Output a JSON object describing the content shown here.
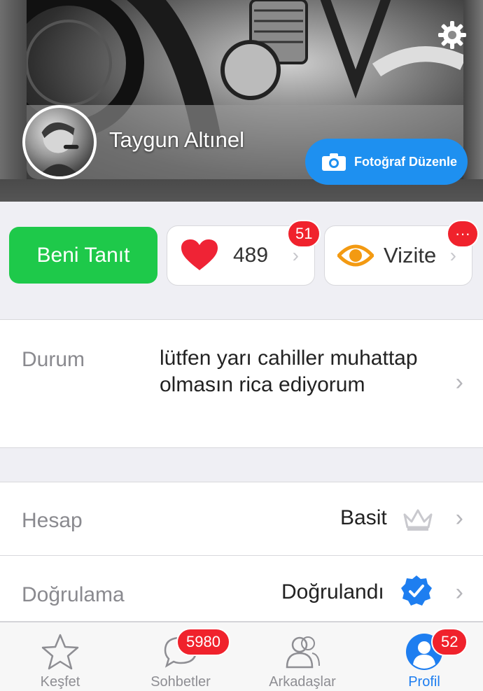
{
  "profile": {
    "name": "Taygun Altınel",
    "edit_photo_label": "Fotoğraf Düzenle"
  },
  "actions": {
    "intro_label": "Beni Tanıt",
    "likes_count": "489",
    "likes_badge": "51",
    "visits_label": "Vizite",
    "visits_badge": "···"
  },
  "status": {
    "label": "Durum",
    "text": "lütfen yarı cahiller muhattap olmasın rica ediyorum"
  },
  "account": {
    "label": "Hesap",
    "value": "Basit"
  },
  "verification": {
    "label": "Doğrulama",
    "value": "Doğrulandı"
  },
  "tabs": [
    {
      "label": "Keşfet",
      "icon": "star-icon"
    },
    {
      "label": "Sohbetler",
      "icon": "chat-icon",
      "badge": "5980"
    },
    {
      "label": "Arkadaşlar",
      "icon": "friends-icon"
    },
    {
      "label": "Profil",
      "icon": "profile-icon",
      "badge": "52"
    }
  ],
  "colors": {
    "green": "#1ec94a",
    "blue": "#1e90f0",
    "red": "#f0222c",
    "active_tab": "#1e7ef0"
  }
}
